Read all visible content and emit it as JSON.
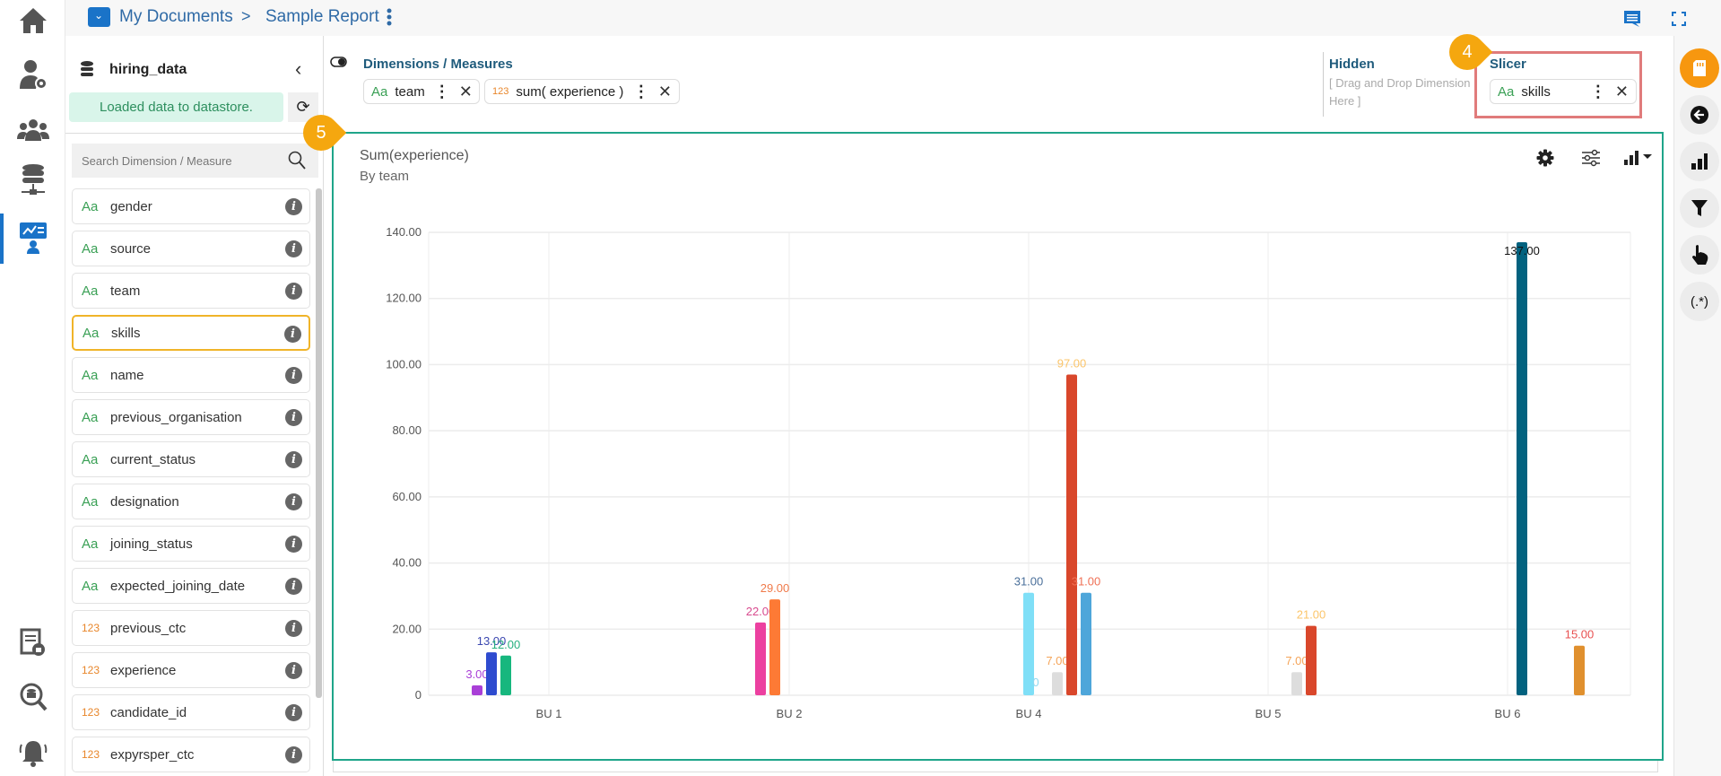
{
  "header": {
    "breadcrumb_root": "My Documents",
    "breadcrumb_separator": ">",
    "report_name": "Sample Report",
    "icons": [
      "folder-icon",
      "kebab-icon",
      "comment-icon",
      "fullscreen-icon"
    ]
  },
  "rail": {
    "items": [
      "home",
      "user-settings",
      "users",
      "data-connectors",
      "designer",
      "reports",
      "data-search",
      "alerts"
    ],
    "active": "designer",
    "accent": "#1a73c8"
  },
  "fieldpanel": {
    "dataset": "hiring_data",
    "status": "Loaded data to datastore.",
    "search_placeholder": "Search Dimension / Measure",
    "fields": [
      {
        "type": "Aa",
        "name": "gender"
      },
      {
        "type": "Aa",
        "name": "source"
      },
      {
        "type": "Aa",
        "name": "team"
      },
      {
        "type": "Aa",
        "name": "skills",
        "selected": true
      },
      {
        "type": "Aa",
        "name": "name"
      },
      {
        "type": "Aa",
        "name": "previous_organisation"
      },
      {
        "type": "Aa",
        "name": "current_status"
      },
      {
        "type": "Aa",
        "name": "designation"
      },
      {
        "type": "Aa",
        "name": "joining_status"
      },
      {
        "type": "Aa",
        "name": "expected_joining_date"
      },
      {
        "type": "123",
        "name": "previous_ctc"
      },
      {
        "type": "123",
        "name": "experience"
      },
      {
        "type": "123",
        "name": "candidate_id"
      },
      {
        "type": "123",
        "name": "expyrsper_ctc"
      }
    ]
  },
  "dropzones": {
    "dims_title": "Dimensions / Measures",
    "dims": [
      {
        "type": "Aa",
        "name": "team"
      },
      {
        "type": "123",
        "name": "sum( experience )"
      }
    ],
    "hidden_title": "Hidden",
    "hidden_placeholder_1": "[ Drag and Drop Dimension",
    "hidden_placeholder_2": "Here ]",
    "slicer_title": "Slicer",
    "slicer": {
      "type": "Aa",
      "name": "skills"
    }
  },
  "callouts": {
    "slicer": "4",
    "chart": "5"
  },
  "chart": {
    "title": "Sum(experience)",
    "subtitle": "By team",
    "border_color": "#1fa58a"
  },
  "chart_data": {
    "type": "bar",
    "title": "Sum(experience)",
    "subtitle": "By team",
    "categories": [
      "BU 1",
      "BU 2",
      "BU 4",
      "BU 5",
      "BU 6"
    ],
    "ylim": [
      0,
      140
    ],
    "yticks": [
      "0",
      "20.00",
      "40.00",
      "60.00",
      "80.00",
      "100.00",
      "120.00",
      "140.00"
    ],
    "grid": true,
    "legend": "none",
    "series": [
      {
        "color": "#a93fd7",
        "values": [
          3,
          null,
          null,
          null,
          null
        ],
        "labels": [
          "3.00",
          null,
          null,
          null,
          null
        ],
        "label_colors": [
          "#a93fd7",
          null,
          null,
          null,
          null
        ]
      },
      {
        "color": "#2e4bcf",
        "values": [
          13,
          null,
          null,
          null,
          null
        ],
        "labels": [
          "13.00",
          null,
          null,
          null,
          null
        ],
        "label_colors": [
          "#3a47b0",
          null,
          null,
          null,
          null
        ]
      },
      {
        "color": "#17b77e",
        "values": [
          12,
          null,
          null,
          null,
          null
        ],
        "labels": [
          "12.00",
          null,
          null,
          null,
          null
        ],
        "label_colors": [
          "#26b07f",
          null,
          null,
          null,
          null
        ]
      },
      {
        "color": "#ec40a0",
        "values": [
          null,
          22,
          null,
          null,
          null
        ],
        "labels": [
          null,
          "22.00",
          null,
          null,
          null
        ],
        "label_colors": [
          null,
          "#d84a8e",
          null,
          null,
          null
        ]
      },
      {
        "color": "#fd7a35",
        "values": [
          null,
          29,
          null,
          null,
          null
        ],
        "labels": [
          null,
          "29.00",
          null,
          null,
          null
        ],
        "label_colors": [
          null,
          "#f07a4a",
          null,
          null,
          null
        ]
      },
      {
        "color": "#7fdff7",
        "values": [
          null,
          null,
          31,
          null,
          null
        ],
        "labels": [
          null,
          null,
          "31.00",
          null,
          null
        ],
        "label_colors": [
          null,
          null,
          "#4a6f9a",
          null,
          null
        ]
      },
      {
        "color": "#02627f",
        "values": [
          null,
          null,
          0,
          null,
          137
        ],
        "labels": [
          null,
          null,
          "0",
          null,
          "137.00"
        ],
        "label_colors": [
          null,
          null,
          "#8fd8f0",
          null,
          "#111111"
        ]
      },
      {
        "color": "#dddddd",
        "values": [
          null,
          null,
          7,
          7,
          null
        ],
        "labels": [
          null,
          null,
          "7.00",
          "7.00",
          null
        ],
        "label_colors": [
          null,
          null,
          "#f5a55a",
          "#f5a55a",
          null
        ]
      },
      {
        "color": "#d9472b",
        "values": [
          null,
          null,
          97,
          21,
          null
        ],
        "labels": [
          null,
          null,
          "97.00",
          "21.00",
          null
        ],
        "label_colors": [
          null,
          null,
          "#fbc56a",
          "#fbc56a",
          null
        ]
      },
      {
        "color": "#4ea6da",
        "values": [
          null,
          null,
          31,
          null,
          null
        ],
        "labels": [
          null,
          null,
          "31.00",
          null,
          null
        ],
        "label_colors": [
          null,
          null,
          "#ef7055",
          null,
          null
        ]
      },
      {
        "color": "#e0902e",
        "values": [
          null,
          null,
          null,
          null,
          15
        ],
        "labels": [
          null,
          null,
          null,
          null,
          "15.00"
        ],
        "label_colors": [
          null,
          null,
          null,
          null,
          "#e85050"
        ]
      }
    ]
  },
  "rightpanel": {
    "items": [
      "sd-card",
      "back-arrow",
      "bar-chart",
      "filter",
      "pointer",
      "regex"
    ],
    "regex_label": "(.*)",
    "active_color": "#f7970f"
  }
}
